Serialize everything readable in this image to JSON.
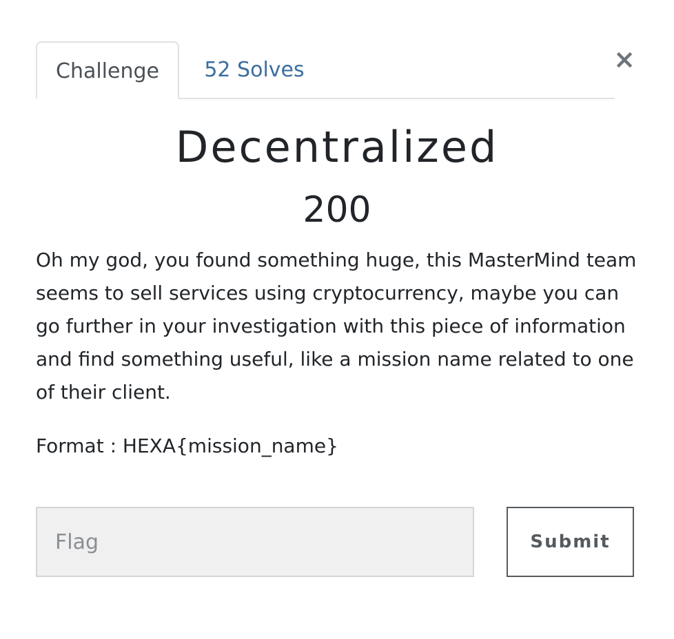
{
  "tabs": [
    {
      "label": "Challenge",
      "active": true
    },
    {
      "label": "52 Solves",
      "active": false
    }
  ],
  "close_glyph": "×",
  "challenge": {
    "name": "Decentralized",
    "value": "200",
    "description": "Oh my god, you found something huge, this MasterMind team seems to sell services using cryptocurrency, maybe you can go further in your investigation with this piece of information and find something useful, like a mission name related to one of their client.",
    "format": "Format : HEXA{mission_name}"
  },
  "form": {
    "flag_placeholder": "Flag",
    "flag_value": "",
    "submit_label": "Submit"
  },
  "colors": {
    "link": "#3c6e9f",
    "text": "#212529",
    "input_bg": "#f0f0f0",
    "border": "#dee2e6"
  }
}
